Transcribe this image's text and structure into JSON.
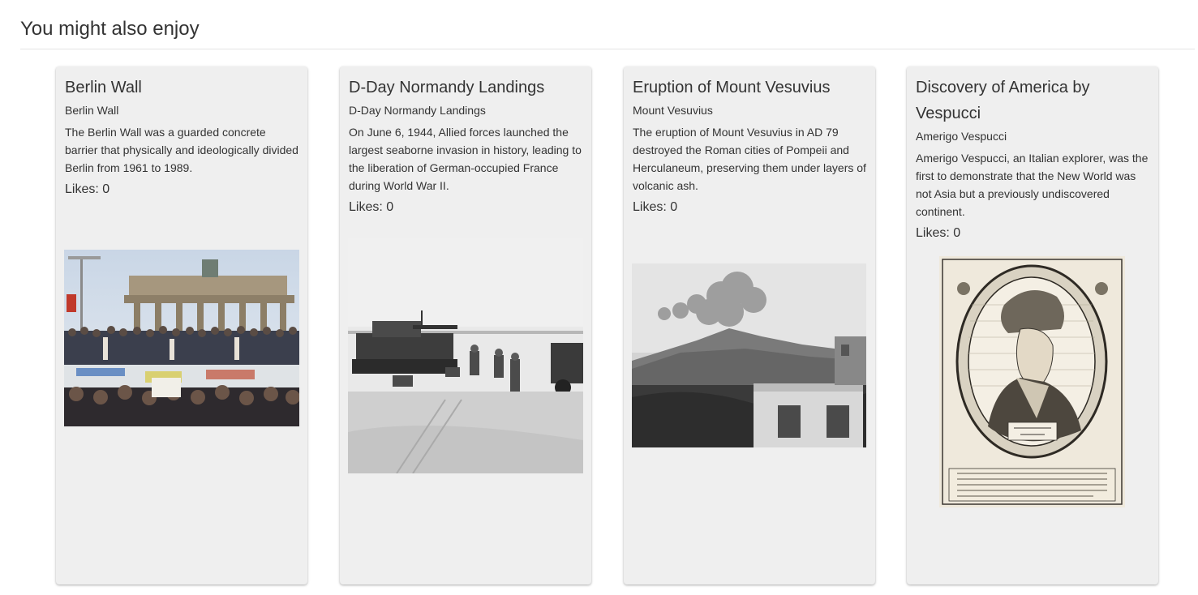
{
  "section": {
    "title": "You might also enjoy"
  },
  "cards": [
    {
      "title": "Berlin Wall",
      "subtitle": "Berlin Wall",
      "description": "The Berlin Wall was a guarded concrete barrier that physically and ideologically divided Berlin from 1961 to 1989.",
      "likes": "Likes: 0",
      "image": "berlin-wall-photo"
    },
    {
      "title": "D-Day Normandy Landings",
      "subtitle": "D-Day Normandy Landings",
      "description": "On June 6, 1944, Allied forces launched the largest seaborne invasion in history, leading to the liberation of German-occupied France during World War II.",
      "likes": "Likes: 0",
      "image": "normandy-landings-photo"
    },
    {
      "title": "Eruption of Mount Vesuvius",
      "subtitle": "Mount Vesuvius",
      "description": "The eruption of Mount Vesuvius in AD 79 destroyed the Roman cities of Pompeii and Herculaneum, preserving them under layers of volcanic ash.",
      "likes": "Likes: 0",
      "image": "vesuvius-eruption-photo"
    },
    {
      "title": "Discovery of America by Vespucci",
      "subtitle": "Amerigo Vespucci",
      "description": "Amerigo Vespucci, an Italian explorer, was the first to demonstrate that the New World was not Asia but a previously undiscovered continent.",
      "likes": "Likes: 0",
      "image": "vespucci-engraving-portrait"
    }
  ],
  "colors": {
    "card_background": "#efefef",
    "text": "#333333",
    "divider": "#e3e3e3"
  }
}
